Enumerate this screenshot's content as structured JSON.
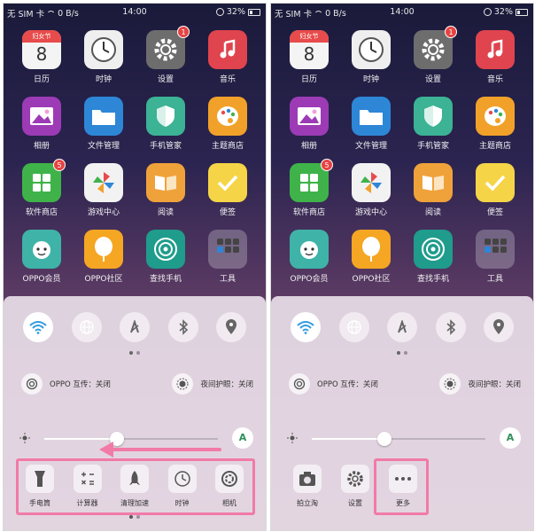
{
  "status_bar": {
    "carrier": "无 SIM 卡",
    "speed": "0 B/s",
    "time": "14:00",
    "battery": "32%"
  },
  "apps": [
    {
      "label": "日历",
      "icon": "calendar-icon",
      "header": "妇女节",
      "day": "8",
      "badge": ""
    },
    {
      "label": "时钟",
      "icon": "clock-icon",
      "badge": ""
    },
    {
      "label": "设置",
      "icon": "gear-icon",
      "badge": "1"
    },
    {
      "label": "音乐",
      "icon": "music-note-icon",
      "badge": ""
    },
    {
      "label": "相册",
      "icon": "gallery-icon",
      "badge": ""
    },
    {
      "label": "文件管理",
      "icon": "folder-icon",
      "badge": ""
    },
    {
      "label": "手机管家",
      "icon": "shield-icon",
      "badge": ""
    },
    {
      "label": "主题商店",
      "icon": "palette-icon",
      "badge": ""
    },
    {
      "label": "软件商店",
      "icon": "app-store-icon",
      "badge": "5"
    },
    {
      "label": "游戏中心",
      "icon": "pinwheel-icon",
      "badge": ""
    },
    {
      "label": "阅读",
      "icon": "book-icon",
      "badge": ""
    },
    {
      "label": "便签",
      "icon": "checkmark-note-icon",
      "badge": ""
    },
    {
      "label": "OPPO会员",
      "icon": "mascot-icon",
      "badge": ""
    },
    {
      "label": "OPPO社区",
      "icon": "balloon-icon",
      "badge": ""
    },
    {
      "label": "查找手机",
      "icon": "radar-icon",
      "badge": ""
    },
    {
      "label": "工具",
      "icon": "folder-grid-icon",
      "badge": ""
    }
  ],
  "control_center": {
    "toggles": [
      {
        "name": "wifi",
        "icon": "wifi-icon",
        "on": true
      },
      {
        "name": "network",
        "icon": "globe-icon",
        "on": false
      },
      {
        "name": "data",
        "icon": "signal-icon",
        "on": false
      },
      {
        "name": "bluetooth",
        "icon": "bluetooth-icon",
        "on": false
      },
      {
        "name": "location",
        "icon": "location-pin-icon",
        "on": false
      }
    ],
    "shortcuts": [
      {
        "label": "OPPO 互传：关闭",
        "icon": "share-icon"
      },
      {
        "label": "夜间护眼：关闭",
        "icon": "eye-care-icon"
      }
    ],
    "brightness": {
      "level": 0.42,
      "auto_label": "A"
    },
    "left_tools": [
      {
        "label": "手电筒",
        "icon": "flashlight-icon"
      },
      {
        "label": "计算器",
        "icon": "calculator-icon"
      },
      {
        "label": "清理加速",
        "icon": "rocket-icon"
      },
      {
        "label": "时钟",
        "icon": "clock-icon"
      },
      {
        "label": "相机",
        "icon": "camera-icon"
      }
    ],
    "right_tools": [
      {
        "label": "拍立淘",
        "icon": "camera-icon"
      },
      {
        "label": "设置",
        "icon": "gear-icon"
      },
      {
        "label": "更多",
        "icon": "more-dots-icon"
      }
    ]
  },
  "colors": {
    "accent": "#f27aa6",
    "wifi_on": "#2f9be0",
    "auto_a": "#2f8f5a"
  }
}
